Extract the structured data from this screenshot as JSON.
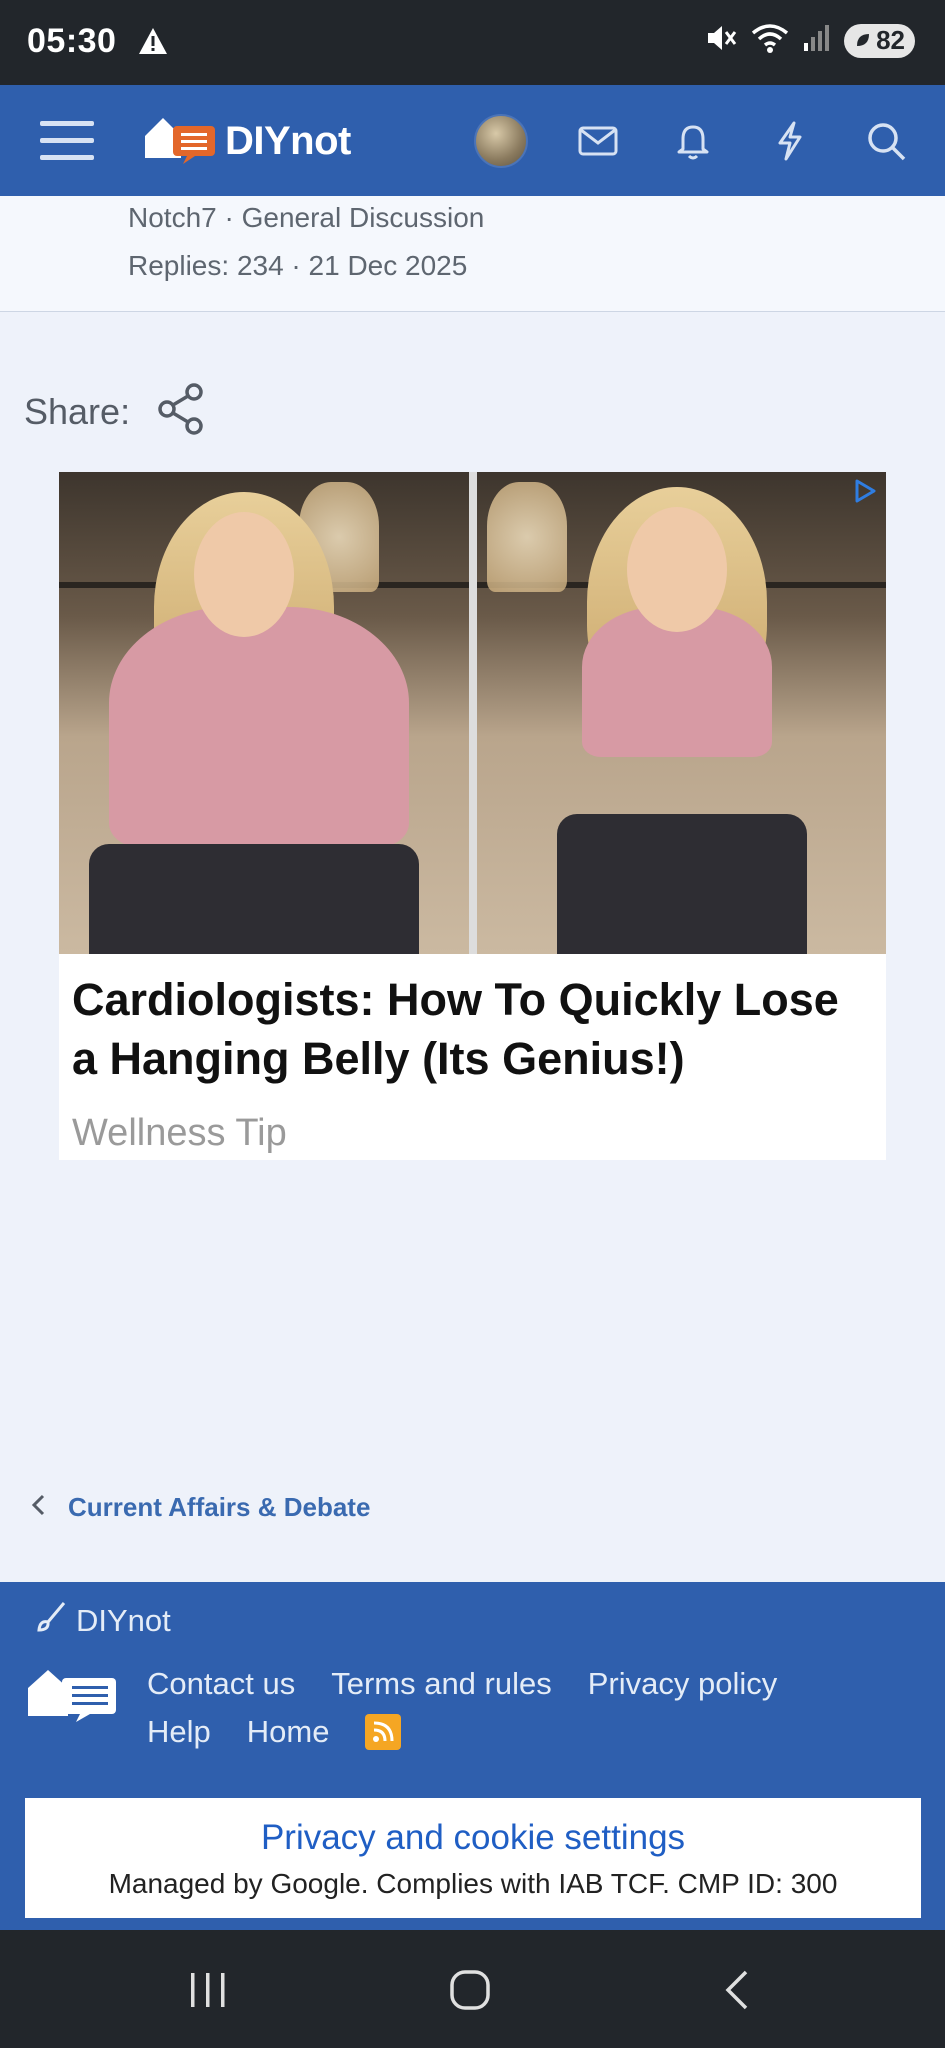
{
  "status_bar": {
    "time": "05:30",
    "battery": "82"
  },
  "nav": {
    "logo_text": "DIYnot",
    "icons": [
      "menu-icon",
      "avatar",
      "mail-icon",
      "bell-icon",
      "lightning-icon",
      "search-icon"
    ]
  },
  "thread_meta": {
    "line1": "Notch7 · General Discussion",
    "line2": "Replies: 234 · 21 Dec 2025"
  },
  "share": {
    "label": "Share:"
  },
  "ad": {
    "title": "Cardiologists: How To Quickly Lose a Hanging Belly (Its Genius!)",
    "source": "Wellness Tip"
  },
  "breadcrumb": {
    "label": "Current Affairs & Debate"
  },
  "footer": {
    "brand": "DIYnot",
    "links_row1": [
      "Contact us",
      "Terms and rules",
      "Privacy policy"
    ],
    "links_row2": [
      "Help",
      "Home"
    ]
  },
  "privacy_banner": {
    "title": "Privacy and cookie settings",
    "subtitle": "Managed by Google. Complies with IAB TCF. CMP ID: 300"
  },
  "colors": {
    "header_blue": "#2f5fad",
    "link_blue": "#3a6ab0",
    "page_bg": "#eef2fa",
    "logo_orange": "#e3672a"
  }
}
